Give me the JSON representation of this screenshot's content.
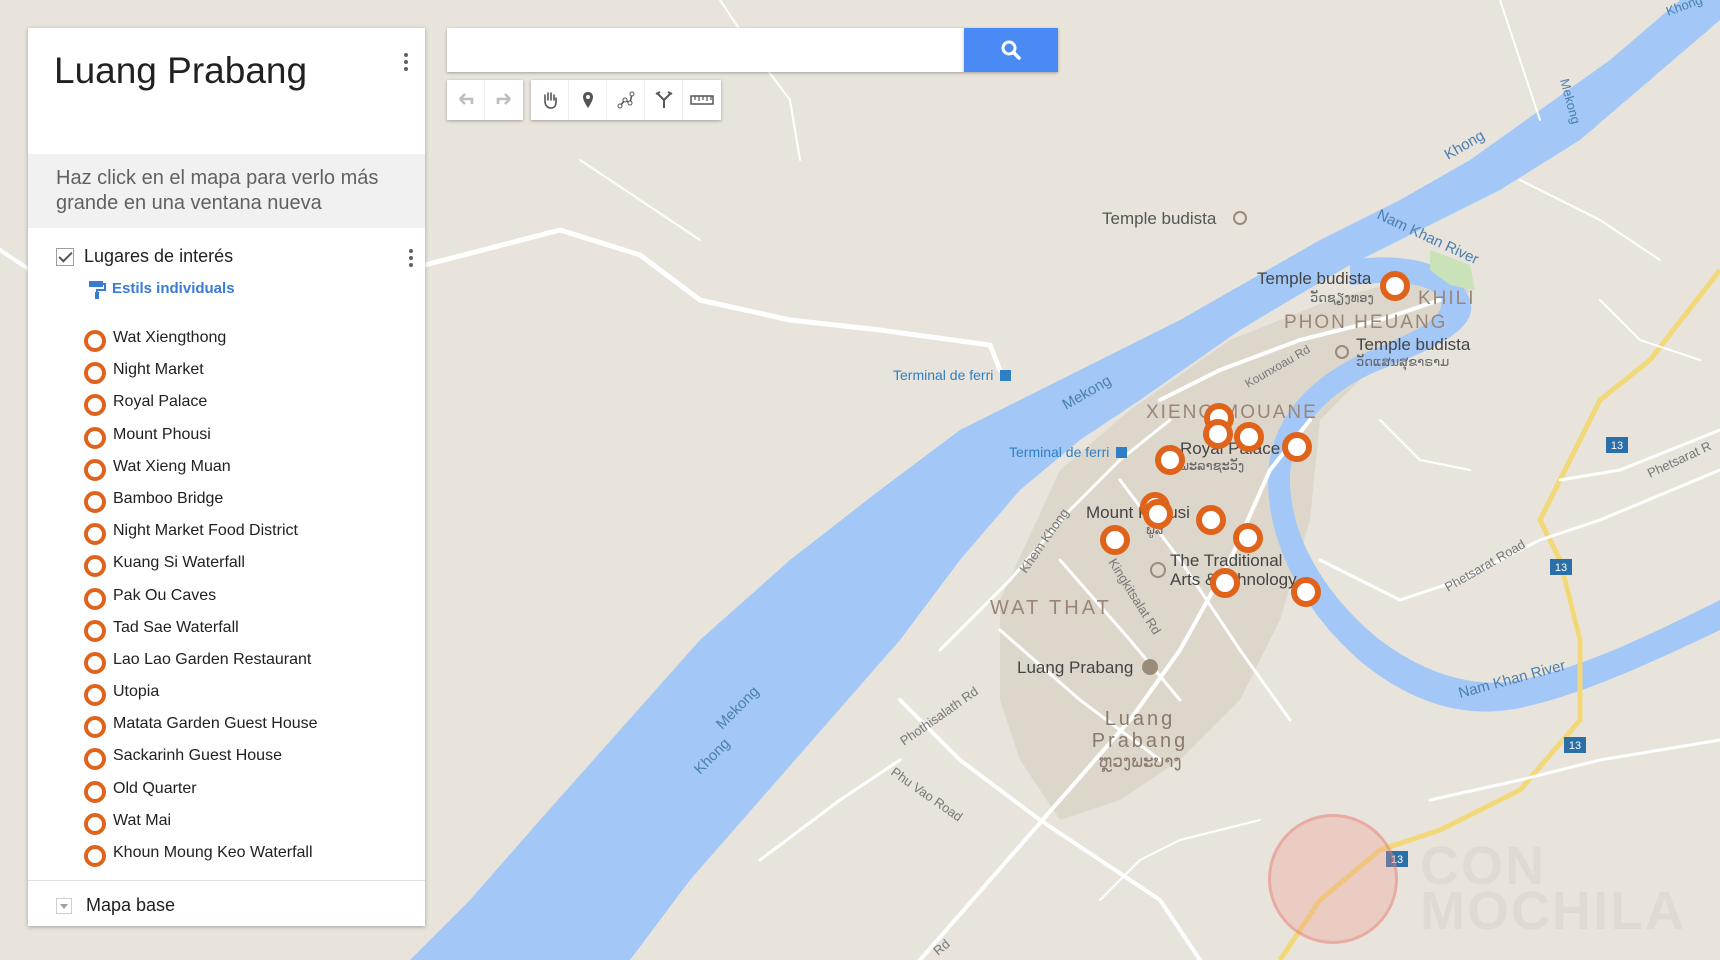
{
  "panel": {
    "title": "Luang Prabang",
    "description": "Haz click en el mapa para verlo más grande en una ventana nueva",
    "layer": {
      "title": "Lugares de interés",
      "style_link": "Estils individuals",
      "items": [
        "Wat Xiengthong",
        "Night Market",
        "Royal Palace",
        "Mount Phousi",
        "Wat Xieng Muan",
        "Bamboo Bridge",
        "Night Market Food District",
        "Kuang Si Waterfall",
        "Pak Ou Caves",
        "Tad Sae Waterfall",
        "Lao Lao Garden Restaurant",
        "Utopia",
        "Matata Garden Guest House",
        "Sackarinh Guest House",
        "Old Quarter",
        "Wat Mai",
        "Khoun Moung Keo Waterfall"
      ]
    },
    "base_map_label": "Mapa base"
  },
  "search": {
    "value": "",
    "placeholder": ""
  },
  "toolbar": {
    "buttons": [
      "undo-icon",
      "redo-icon",
      "hand-icon",
      "marker-icon",
      "draw-line-icon",
      "directions-icon",
      "ruler-icon"
    ]
  },
  "colors": {
    "water": "#a3c8f7",
    "land": "#e8e4dc",
    "road": "#ffffff",
    "urban": "#ddd7cb",
    "highway": "#f3d87a",
    "marker": "#e0631b",
    "search_button": "#4a8af4",
    "link": "#3a7bd5"
  },
  "map": {
    "labels": {
      "temple_budista_1": "Temple budista",
      "temple_budista_2": "Temple budista",
      "temple_budista_2_lao": "ວັດຊຽງທອງ",
      "temple_budista_3": "Temple budista",
      "temple_budista_3_lao": "ວັດແສນສຸຂາຣາມ",
      "khili": "KHILI",
      "phon_heuang": "PHON HEUANG",
      "xieng_mouane": "XIENG MOUANE",
      "royal_palace": "Royal Palace",
      "royal_palace_lao": "ພະລາຊະວັງ",
      "mount_phousi": "Mount Phousi",
      "mount_phousi_lao": "ພູສີ",
      "traditional_arts_1": "The Traditional",
      "traditional_arts_2": "Arts & Ethnology...",
      "wat_that": "WAT THAT",
      "luang_prabang_poi": "Luang Prabang",
      "luang_prabang_town_1": "Luang",
      "luang_prabang_town_2": "Prabang",
      "luang_prabang_lao": "ຫຼວງພະບາງ",
      "terminal_ferri_1": "Terminal de ferri",
      "terminal_ferri_2": "Terminal de ferri",
      "mekong_1": "Mekong",
      "mekong_2": "Mekong",
      "mekong_3": "Mekong",
      "khong_1": "Khong",
      "khong_2": "Khong",
      "khong_3": "Khong",
      "nam_khan_1": "Nam Khan River",
      "nam_khan_2": "Nam Khan River",
      "kounxoau_rd": "Kounxoau Rd",
      "khem_khong": "Khem Khong",
      "kingkitsalat_rd": "Kingkitsalat Rd",
      "phothisalath_rd": "Phothisalath Rd",
      "phu_vao_road": "Phu Vao Road",
      "phetsarat_road": "Phetsarat Road",
      "phetsarat_r": "Phetsarat R",
      "rd_bottom": "Rd",
      "route_13": "13",
      "watermark_1": "CON",
      "watermark_2": "MOCHILA"
    }
  }
}
